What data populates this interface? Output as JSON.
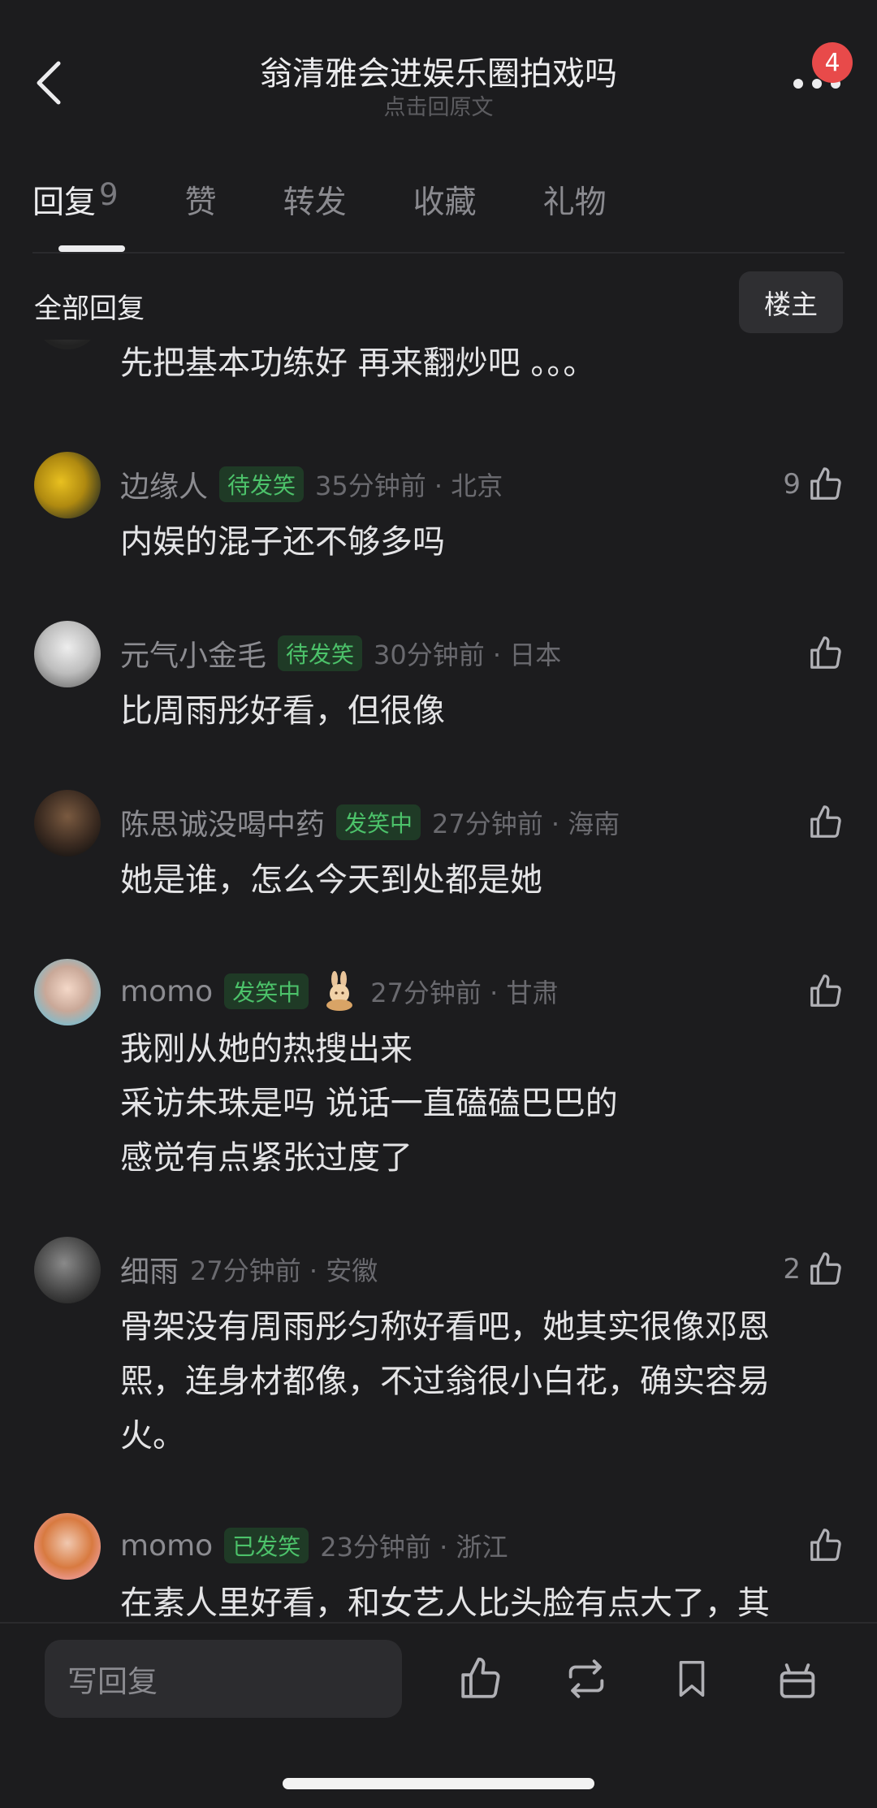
{
  "header": {
    "title": "翁清雅会进娱乐圈拍戏吗",
    "subtitle": "点击回原文",
    "notification_count": "4"
  },
  "tabs": [
    {
      "label": "回复",
      "count": "9",
      "active": true
    },
    {
      "label": "赞"
    },
    {
      "label": "转发"
    },
    {
      "label": "收藏"
    },
    {
      "label": "礼物"
    }
  ],
  "section": {
    "title": "全部回复",
    "filter_button": "楼主"
  },
  "comments": [
    {
      "body": "先把基本功练好 再来翻炒吧 。。。"
    },
    {
      "name": "边缘人",
      "tag": "待发笑",
      "time": "35分钟前 · 北京",
      "likes": "9",
      "body": "内娱的混子还不够多吗"
    },
    {
      "name": "元气小金毛",
      "tag": "待发笑",
      "time": "30分钟前 · 日本",
      "likes": "",
      "body": "比周雨彤好看，但很像"
    },
    {
      "name": "陈思诚没喝中药",
      "tag": "发笑中",
      "time": "27分钟前 · 海南",
      "likes": "",
      "body": "她是谁，怎么今天到处都是她"
    },
    {
      "name": "momo",
      "tag": "发笑中",
      "time": "27分钟前 · 甘肃",
      "likes": "",
      "body_lines": [
        "我刚从她的热搜出来",
        "采访朱珠是吗 说话一直磕磕巴巴的",
        "感觉有点紧张过度了"
      ]
    },
    {
      "name": "细雨",
      "tag": "",
      "time": "27分钟前 · 安徽",
      "likes": "2",
      "body_lines": [
        "骨架没有周雨彤匀称好看吧，她其实很像邓恩",
        "熙，连身材都像，不过翁很小白花，确实容易",
        "火。"
      ]
    },
    {
      "name": "momo",
      "tag": "已发笑",
      "time": "23分钟前 · 浙江",
      "likes": "",
      "body": "在素人里好看，和女艺人比头脸有点大了，其"
    }
  ],
  "bottom_bar": {
    "reply_placeholder": "写回复"
  },
  "colors": {
    "background": "#1c1c1e",
    "tag_green": "#4cc26a",
    "badge_red": "#e84a4a"
  }
}
